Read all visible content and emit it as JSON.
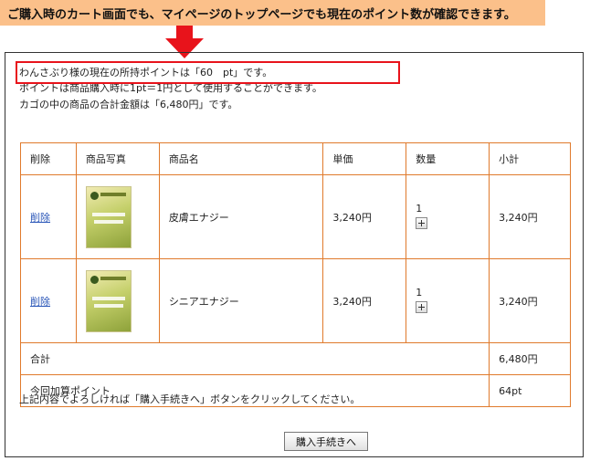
{
  "banner": {
    "text": "ご購入時のカート画面でも、マイページのトップページでも現在のポイント数が確認できます。"
  },
  "info": {
    "line1": "わんさぶり様の現在の所持ポイントは「60　pt」です。",
    "line2": "ポイントは商品購入時に1pt＝1円として使用することができます。",
    "line3": "カゴの中の商品の合計金額は「6,480円」です。"
  },
  "cart": {
    "headers": [
      "削除",
      "商品写真",
      "商品名",
      "単価",
      "数量",
      "小計"
    ],
    "items": [
      {
        "delete": "削除",
        "name": "皮膚エナジー",
        "price": "3,240円",
        "qty": "1",
        "subtotal": "3,240円"
      },
      {
        "delete": "削除",
        "name": "シニアエナジー",
        "price": "3,240円",
        "qty": "1",
        "subtotal": "3,240円"
      }
    ],
    "total_label": "合計",
    "total_value": "6,480円",
    "points_label": "今回加算ポイント",
    "points_value": "64pt"
  },
  "footer": {
    "note": "上記内容でよろしければ「購入手続きへ」ボタンをクリックしてください。",
    "button": "購入手続きへ"
  },
  "colors": {
    "banner": "#fbc08a",
    "table_border": "#e07a2c",
    "highlight": "#e8131b",
    "link": "#2a56b8"
  }
}
